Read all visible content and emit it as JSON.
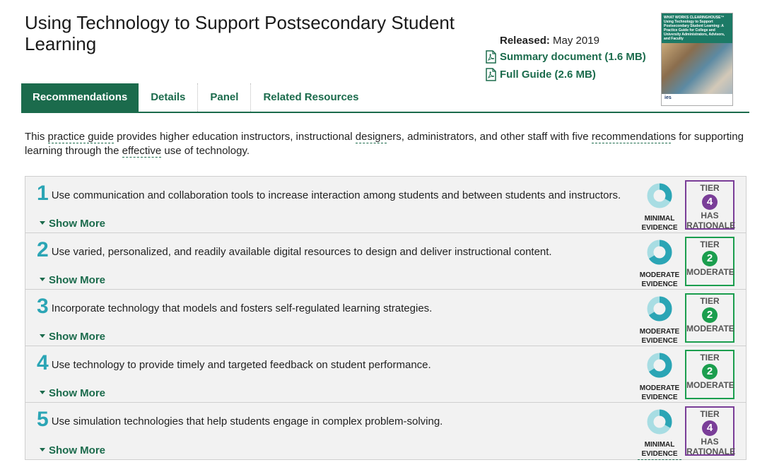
{
  "header": {
    "title": "Using Technology to Support Postsecondary Student Learning",
    "released_label": "Released:",
    "released_value": "May 2019",
    "summary_link": "Summary document (1.6 MB)",
    "full_guide_link": "Full Guide (2.6 MB)"
  },
  "cover": {
    "top_text": "WHAT WORKS CLEARINGHOUSE™ Using Technology to Support Postsecondary Student Learning: A Practice Guide for College and University Administrators, Advisors, and Faculty",
    "foot_text": "ies"
  },
  "tabs": [
    {
      "label": "Recommendations",
      "active": true
    },
    {
      "label": "Details",
      "active": false
    },
    {
      "label": "Panel",
      "active": false
    },
    {
      "label": "Related Resources",
      "active": false
    }
  ],
  "intro": {
    "p1": "This ",
    "w1": "practice guide",
    "p2": " provides higher education instructors, instructional ",
    "w2": "design",
    "p3": "ers, administrators, and other staff with five ",
    "w3": "recommendation",
    "p4": "s for supporting learning through the ",
    "w4": "effective",
    "p5": " use of technology."
  },
  "show_more_label": "Show More",
  "recommendations": [
    {
      "number": "1",
      "text": "Use communication and collaboration tools to increase interaction among students and between students and instructors.",
      "evidence": [
        "MINIMAL",
        "EVIDENCE"
      ],
      "evidence_level": 0.33,
      "tier_label": "TIER",
      "tier_number": "4",
      "tier_desc": [
        "HAS",
        "RATIONALE"
      ]
    },
    {
      "number": "2",
      "text": "Use varied, personalized, and readily available digital resources to design and deliver instructional content.",
      "evidence": [
        "MODERATE",
        "EVIDENCE"
      ],
      "evidence_level": 0.66,
      "tier_label": "TIER",
      "tier_number": "2",
      "tier_desc": [
        "MODERATE"
      ]
    },
    {
      "number": "3",
      "text": "Incorporate technology that models and fosters self-regulated learning strategies.",
      "evidence": [
        "MODERATE",
        "EVIDENCE"
      ],
      "evidence_level": 0.66,
      "tier_label": "TIER",
      "tier_number": "2",
      "tier_desc": [
        "MODERATE"
      ]
    },
    {
      "number": "4",
      "text": "Use technology to provide timely and targeted feedback on student performance.",
      "evidence": [
        "MODERATE",
        "EVIDENCE"
      ],
      "evidence_level": 0.66,
      "tier_label": "TIER",
      "tier_number": "2",
      "tier_desc": [
        "MODERATE"
      ]
    },
    {
      "number": "5",
      "text": "Use simulation technologies that help students engage in complex problem-solving.",
      "evidence": [
        "MINIMAL",
        "EVIDENCE"
      ],
      "evidence_level": 0.33,
      "tier_label": "TIER",
      "tier_number": "4",
      "tier_desc": [
        "HAS",
        "RATIONALE"
      ]
    }
  ],
  "colors": {
    "brand_green": "#1b6b4c",
    "number_teal": "#2ba5b5",
    "tier2_green": "#1b9e4e",
    "tier4_purple": "#7a3e98"
  }
}
